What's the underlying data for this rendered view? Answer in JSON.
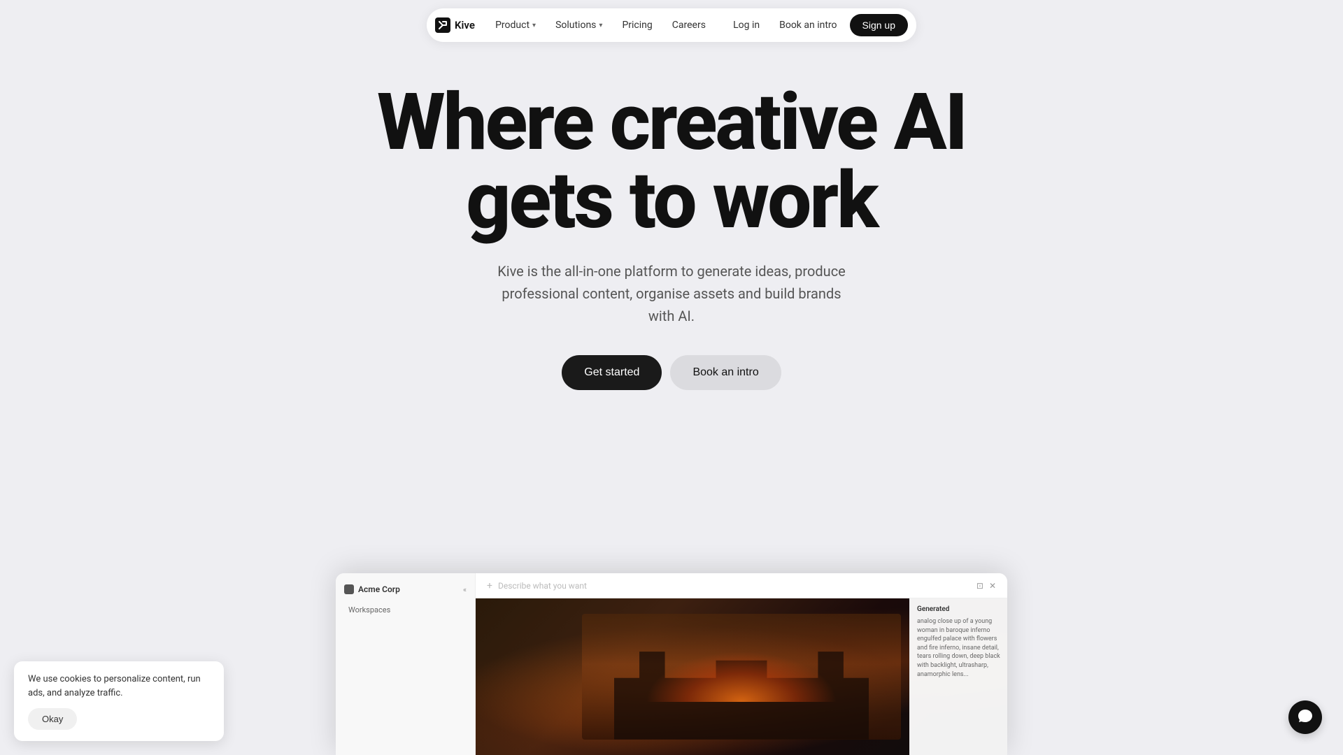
{
  "navbar": {
    "logo_text": "Kive",
    "logo_icon": "K",
    "nav_items": [
      {
        "label": "Product",
        "has_dropdown": true
      },
      {
        "label": "Solutions",
        "has_dropdown": true
      },
      {
        "label": "Pricing",
        "has_dropdown": false
      },
      {
        "label": "Careers",
        "has_dropdown": false
      }
    ],
    "login_label": "Log in",
    "book_label": "Book an intro",
    "signup_label": "Sign up"
  },
  "hero": {
    "title_line1": "Where creative AI",
    "title_line2": "gets to work",
    "subtitle": "Kive is the all-in-one platform to generate ideas, produce professional content, organise assets and build brands with AI.",
    "cta_primary": "Get started",
    "cta_secondary": "Book an intro"
  },
  "preview": {
    "workspace_name": "Acme Corp",
    "toolbar_placeholder": "Describe what you want",
    "generated_label": "Generated",
    "generated_text": "analog close up of a young woman in baroque inferno engulfed palace with flowers and fire inferno, insane detail, tears rolling down, deep black with backlight, ultrasharp, anamorphic lens..."
  },
  "cookie": {
    "text": "We use cookies to personalize content, run ads, and analyze traffic.",
    "okay_label": "Okay"
  },
  "colors": {
    "bg": "#EEEEF2",
    "nav_bg": "#ffffff",
    "primary_btn": "#1a1a1a",
    "secondary_btn": "rgba(0,0,0,0.08)"
  }
}
